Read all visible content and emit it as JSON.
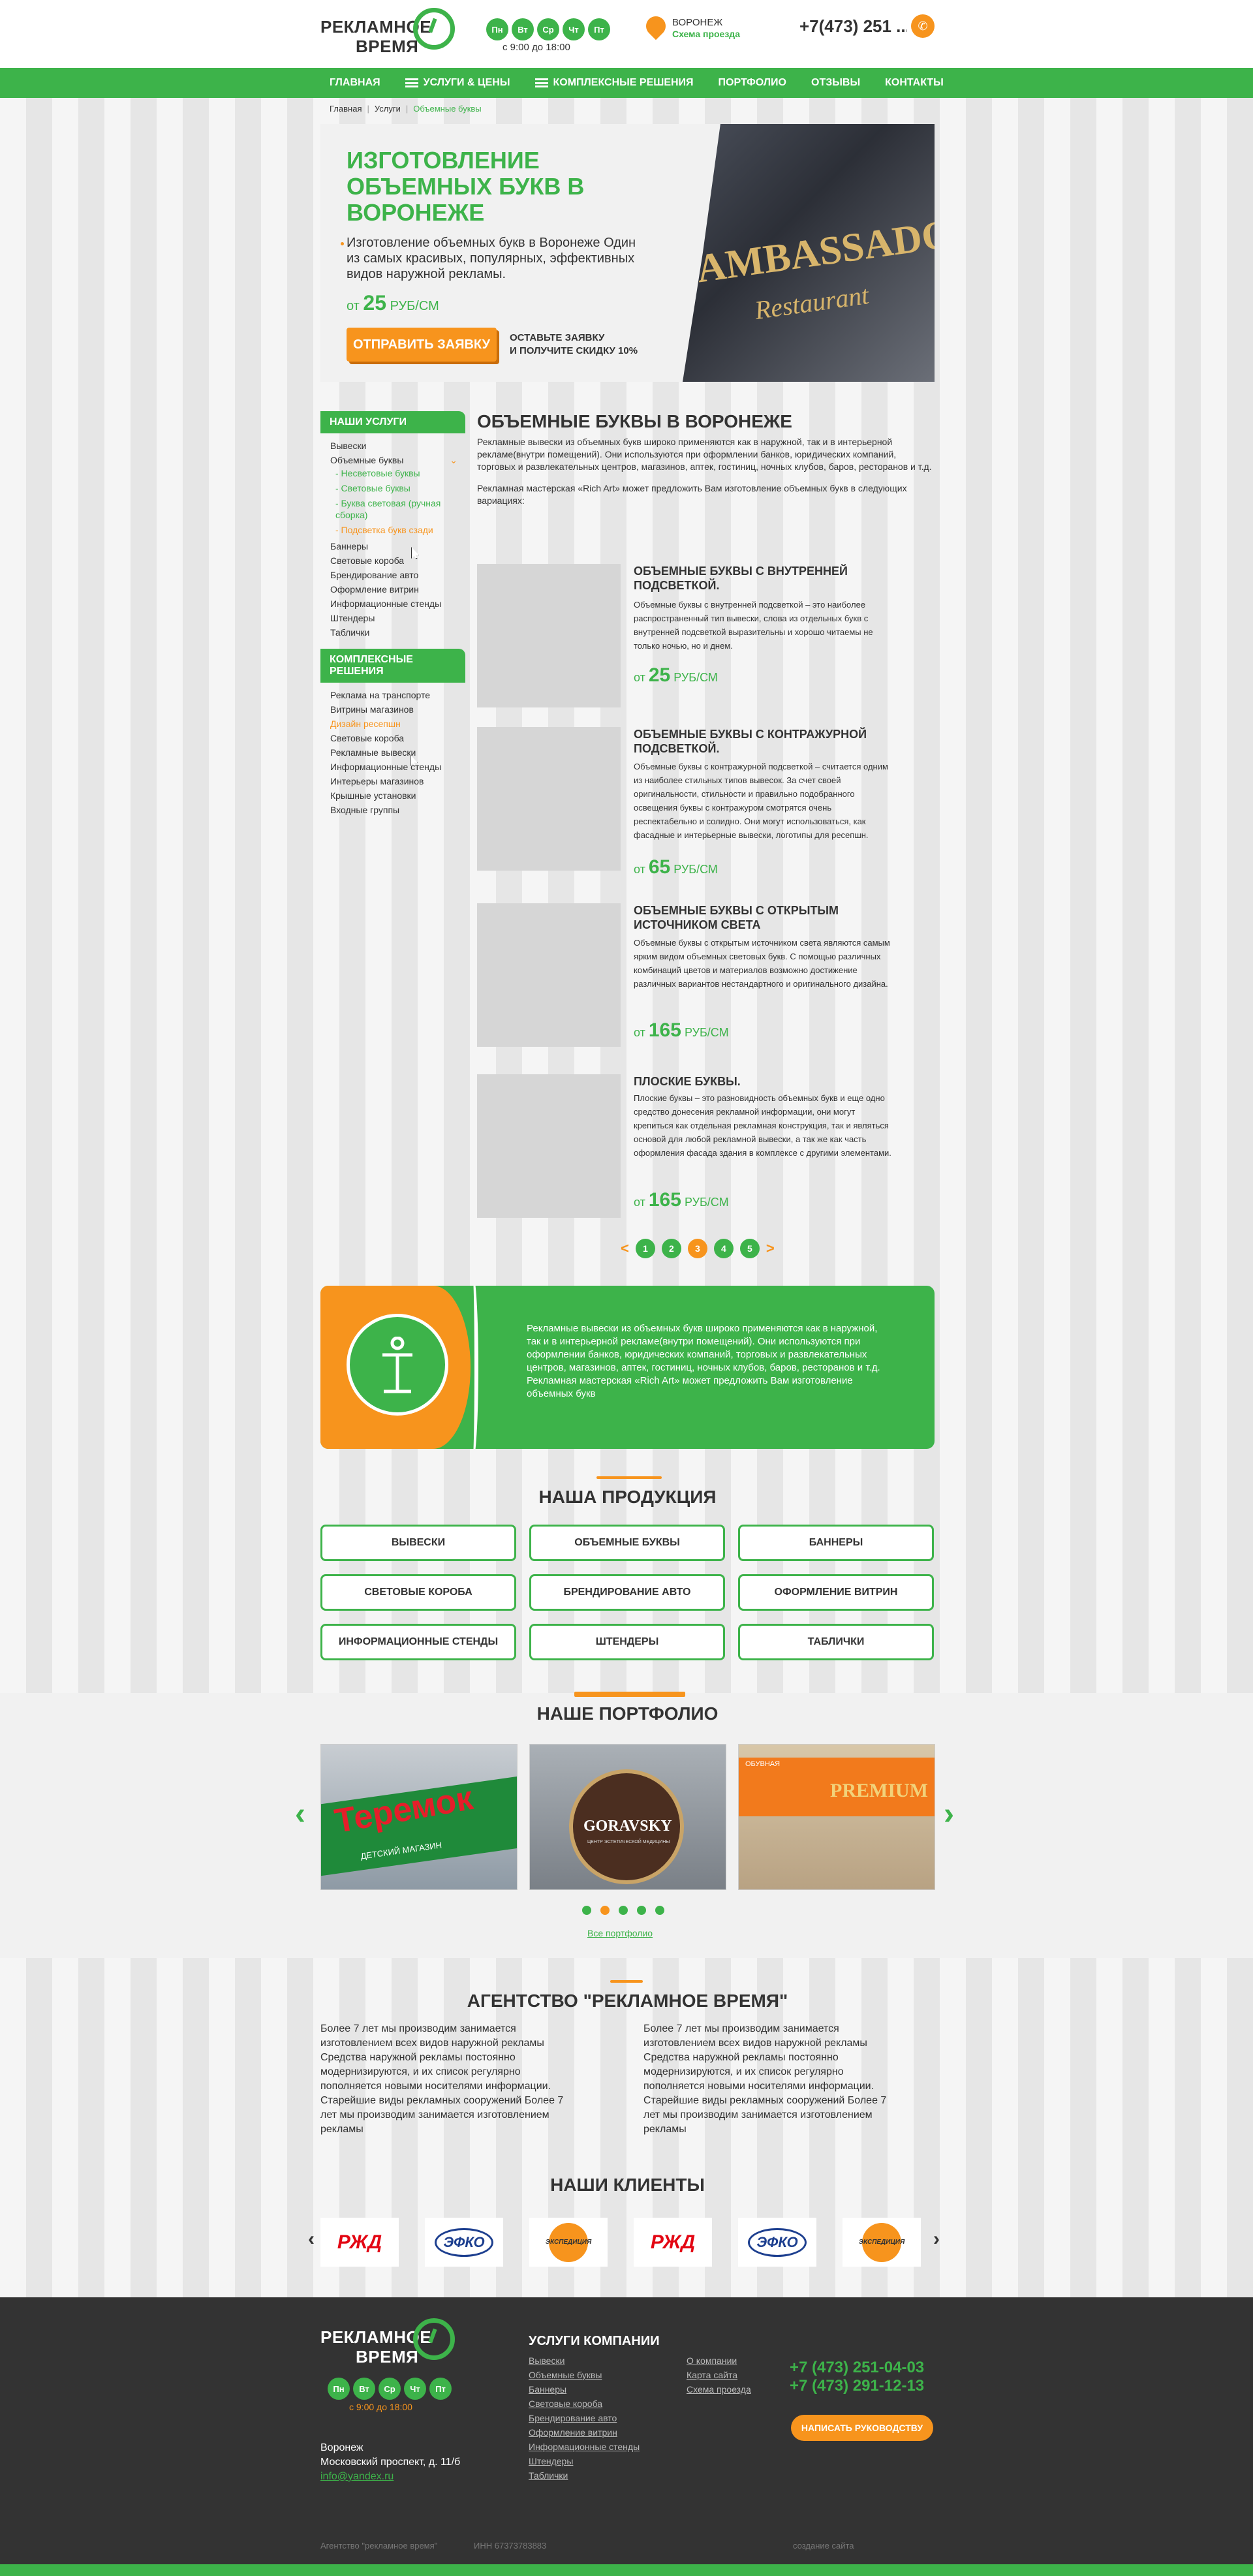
{
  "header": {
    "logo_line1": "РЕКЛАМНОЕ",
    "logo_line2": "ВРЕМЯ",
    "days": [
      "Пн",
      "Вт",
      "Ср",
      "Чт",
      "Пт"
    ],
    "hours": "с 9:00 до 18:00",
    "city": "ВОРОНЕЖ",
    "route_link": "Схема проезда",
    "phone": "+7(473) 251 ..."
  },
  "nav": {
    "items": [
      "ГЛАВНАЯ",
      "УСЛУГИ & ЦЕНЫ",
      "КОМПЛЕКСНЫЕ РЕШЕНИЯ",
      "ПОРТФОЛИО",
      "ОТЗЫВЫ",
      "КОНТАКТЫ"
    ]
  },
  "breadcrumb": {
    "home": "Главная",
    "services": "Услуги",
    "current": "Объемные буквы"
  },
  "hero": {
    "title": "ИЗГОТОВЛЕНИЕ ОБЪЕМНЫХ БУКВ В ВОРОНЕЖЕ",
    "subtitle": "Изготовление объемных букв в Воронеже Один из самых красивых, популярных, эффективных видов наружной рекламы.",
    "price_from": "от",
    "price_value": "25",
    "price_unit": "РУБ/СМ",
    "cta": "ОТПРАВИТЬ ЗАЯВКУ",
    "cta_note_1": "ОСТАВЬТЕ ЗАЯВКУ",
    "cta_note_2": "И ПОЛУЧИТЕ СКИДКУ 10%",
    "image_sign": "AMBASSADOR",
    "image_sub": "Restaurant"
  },
  "sidebar": {
    "services_title": "НАШИ УСЛУГИ",
    "services": [
      "Вывески",
      "Объемные буквы"
    ],
    "services_sub": [
      "- Несветовые буквы",
      "- Световые буквы",
      "- Буква световая (ручная сборка)",
      "- Подсветка букв сзади"
    ],
    "services_rest": [
      "Баннеры",
      "Световые короба",
      "Брендирование авто",
      "Оформление витрин",
      "Информационные стенды",
      "Штендеры",
      "Таблички"
    ],
    "solutions_title": "КОМПЛЕКСНЫЕ РЕШЕНИЯ",
    "solutions": [
      "Реклама на транспорте",
      "Витрины магазинов",
      "Дизайн ресепшн",
      "Световые короба",
      "Рекламные вывески",
      "Информационные стенды",
      "Интерьеры магазинов",
      "Крышные установки",
      "Входные группы"
    ]
  },
  "content": {
    "title": "ОБЪЕМНЫЕ БУКВЫ В ВОРОНЕЖЕ",
    "intro": "Рекламные вывески из объемных букв широко применяются как в наружной, так и в интерьерной рекламе(внутри помещений). Они используются при оформлении банков, юридических компаний, торговых и развлекательных центров, магазинов, аптек, гостиниц, ночных клубов, баров, ресторанов и т.д.",
    "intro2": "Рекламная мастерская «Rich Art» может предложить Вам изготовление объемных букв в следующих вариациях:",
    "products": [
      {
        "title": "ОБЪЕМНЫЕ БУКВЫ С ВНУТРЕННЕЙ ПОДСВЕТКОЙ.",
        "desc": "Объемные буквы с внутренней подсветкой – это наиболее распространенный тип вывески, слова из отдельных букв с внутренней подсветкой выразительны и хорошо читаемы не только ночью, но и днем.",
        "from": "от",
        "price": "25",
        "unit": "РУБ/СМ"
      },
      {
        "title": "ОБЪЕМНЫЕ БУКВЫ С КОНТРАЖУРНОЙ ПОДСВЕТКОЙ.",
        "desc": "Объемные буквы с контражурной подсветкой – считается одним из наиболее стильных типов вывесок. За счет своей оригинальности, стильности и правильно подобранного освещения буквы с контражуром смотрятся очень респектабельно и солидно. Они могут использоваться, как фасадные и интерьерные вывески, логотипы для ресепшн.",
        "from": "от",
        "price": "65",
        "unit": "РУБ/СМ"
      },
      {
        "title": "ОБЪЕМНЫЕ БУКВЫ С ОТКРЫТЫМ ИСТОЧНИКОМ СВЕТА",
        "desc": "Объемные буквы с открытым источником света являются самым ярким видом объемных световых букв. С помощью различных комбинаций цветов и материалов возможно достижение различных вариантов нестандартного и оригинального дизайна.",
        "from": "от",
        "price": "165",
        "unit": "РУБ/СМ"
      },
      {
        "title": "ПЛОСКИЕ БУКВЫ.",
        "desc": "Плоские буквы – это разновидность объемных букв и еще одно средство донесения рекламной информации, они могут крепиться как отдельная рекламная конструкция, так и являться основой для любой рекламной вывески, а так же как часть оформления фасада здания в комплексе с другими элементами.",
        "from": "от",
        "price": "165",
        "unit": "РУБ/СМ"
      }
    ],
    "pager": {
      "prev": "<",
      "pages": [
        "1",
        "2",
        "3",
        "4",
        "5"
      ],
      "next": ">"
    }
  },
  "info": {
    "text": "Рекламные вывески из объемных букв широко применяются как в наружной, так и в интерьерной рекламе(внутри помещений). Они используются при оформлении банков, юридических компаний, торговых и развлекательных центров, магазинов, аптек, гостиниц, ночных клубов, баров, ресторанов и т.д. Рекламная мастерская «Rich Art» может предложить Вам изготовление объемных букв"
  },
  "products": {
    "title": "НАША ПРОДУКЦИЯ",
    "items": [
      "ВЫВЕСКИ",
      "ОБЪЕМНЫЕ БУКВЫ",
      "БАННЕРЫ",
      "СВЕТОВЫЕ КОРОБА",
      "БРЕНДИРОВАНИЕ АВТО",
      "ОФОРМЛЕНИЕ ВИТРИН",
      "ИНФОРМАЦИОННЫЕ СТЕНДЫ",
      "ШТЕНДЕРЫ",
      "ТАБЛИЧКИ"
    ]
  },
  "portfolio": {
    "title": "НАШЕ ПОРТФОЛИО",
    "images": [
      "Теремок",
      "GORAVSKY",
      "PREMIUM"
    ],
    "image_notes": [
      "ДЕТСКИЙ МАГАЗИН",
      "ЦЕНТР ЭСТЕТИЧЕСКОЙ МЕДИЦИНЫ",
      "ОБУВНАЯ"
    ],
    "all_link": "Все портфолио"
  },
  "agency": {
    "title": "АГЕНТСТВО \"РЕКЛАМНОЕ ВРЕМЯ\"",
    "col1": "Более 7 лет мы производим занимается изготовлением всех видов наружной рекламы Средства наружной рекламы постоянно модернизируются, и их список регулярно пополняется новыми носителями информации. Старейшие виды рекламных сооружений Более 7 лет мы производим занимается изготовлением рекламы",
    "col2": "Более 7 лет мы производим занимается изготовлением всех видов наружной рекламы Средства наружной рекламы постоянно модернизируются, и их список регулярно пополняется новыми носителями информации. Старейшие виды рекламных сооружений Более 7 лет мы производим занимается изготовлением рекламы"
  },
  "clients": {
    "title": "НАШИ КЛИЕНТЫ",
    "logos": [
      "РЖД",
      "ЭФКО",
      "ЭКСПЕДИЦИЯ",
      "РЖД",
      "ЭФКО",
      "ЭКСПЕДИЦИЯ"
    ]
  },
  "footer": {
    "address_city": "Воронеж",
    "address_street": "Московский проспект, д. 11/б",
    "email": "info@yandex.ru",
    "services_title": "УСЛУГИ КОМПАНИИ",
    "services": [
      "Вывески",
      "Объемные буквы",
      "Баннеры",
      "Световые короба",
      "Брендирование авто",
      "Оформление витрин",
      "Информационные стенды",
      "Штендеры",
      "Таблички"
    ],
    "links": [
      "О компании",
      "Карта сайта",
      "Схема проезда"
    ],
    "phone1": "+7 (473) 251-04-03",
    "phone2": "+7 (473) 291-12-13",
    "write_btn": "НАПИСАТЬ РУКОВОДСТВУ",
    "copyright": "Агентство \"рекламное время\"",
    "inn": "ИНН 67373783883",
    "dev": "создание сайта"
  },
  "colors": {
    "green": "#3db34a",
    "orange": "#f7941d",
    "dark": "#333333"
  }
}
